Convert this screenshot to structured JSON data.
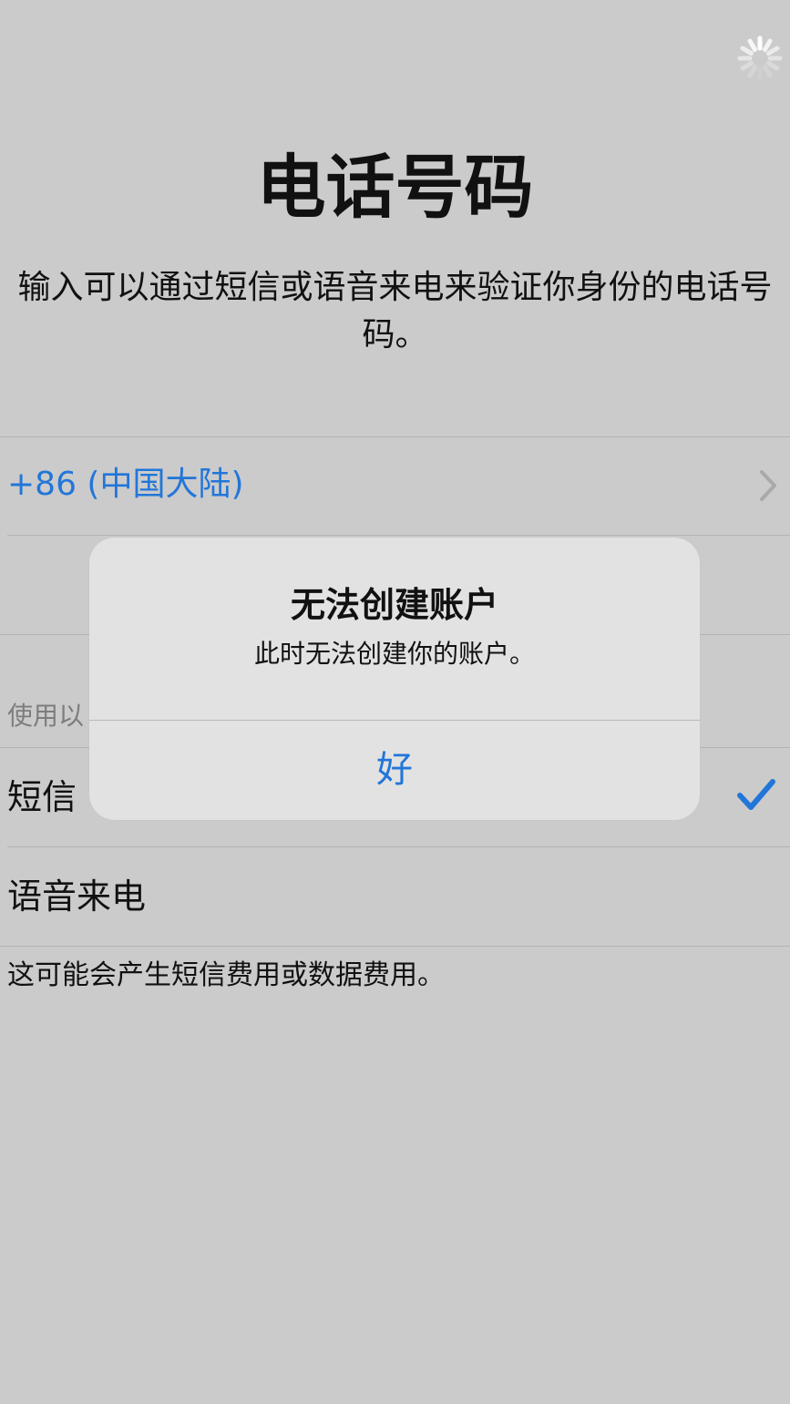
{
  "page": {
    "title": "电话号码",
    "subtitle": "输入可以通过短信或语音来电来验证你身份的电话号码。"
  },
  "country_code": {
    "label": "+86 (中国大陆)"
  },
  "verify_section": {
    "label": "使用以",
    "options": [
      {
        "label": "短信",
        "selected": true
      },
      {
        "label": "语音来电",
        "selected": false
      }
    ],
    "footnote": "这可能会产生短信费用或数据费用。"
  },
  "alert": {
    "title": "无法创建账户",
    "message": "此时无法创建你的账户。",
    "ok_label": "好"
  },
  "icons": {
    "spinner": "loading-spinner-icon",
    "chevron": "chevron-right-icon",
    "check": "checkmark-icon"
  },
  "colors": {
    "background": "#cbcbcb",
    "accent": "#2276d8",
    "alert_background": "#e2e2e2"
  }
}
